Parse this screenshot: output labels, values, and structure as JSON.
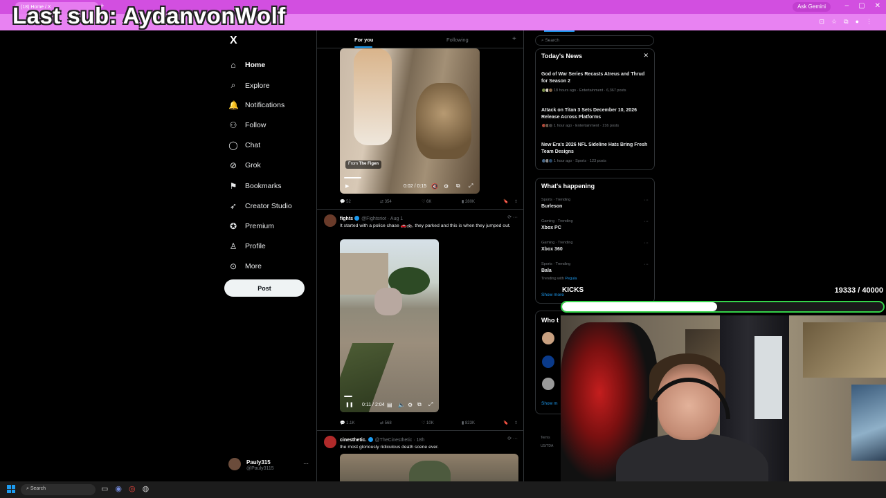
{
  "browser": {
    "tab_title": "(18) Home / X",
    "new_tab": "+",
    "ask_gemini": "Ask Gemini"
  },
  "overlay": {
    "last_sub": "Last sub: AydanvonWolf",
    "goal_label": "KICKS",
    "goal_count": "19333 / 40000",
    "goal_progress": 0.483
  },
  "nav": {
    "logo": "X",
    "items": [
      {
        "label": "Home",
        "icon": "home-icon"
      },
      {
        "label": "Explore",
        "icon": "search-icon"
      },
      {
        "label": "Notifications",
        "icon": "bell-icon"
      },
      {
        "label": "Follow",
        "icon": "add-user-icon"
      },
      {
        "label": "Chat",
        "icon": "chat-icon"
      },
      {
        "label": "Grok",
        "icon": "grok-icon"
      },
      {
        "label": "Bookmarks",
        "icon": "bookmark-icon"
      },
      {
        "label": "Creator Studio",
        "icon": "rocket-icon"
      },
      {
        "label": "Premium",
        "icon": "premium-icon"
      },
      {
        "label": "Profile",
        "icon": "profile-icon"
      },
      {
        "label": "More",
        "icon": "more-icon"
      }
    ],
    "post_label": "Post",
    "account": {
      "name": "Pauly315",
      "handle": "@Pauly3115",
      "more": "···"
    }
  },
  "feed": {
    "tabs": [
      "For you",
      "Following"
    ],
    "plus": "+",
    "tweet1": {
      "from_prefix": "From",
      "from_name": "The Figen",
      "time": "0:02 / 0:15",
      "progress": 0.13,
      "actions": {
        "reply": "52",
        "repost": "354",
        "like": "6K",
        "views": "280K"
      }
    },
    "tweet2": {
      "name": "fights",
      "handle": "@Fightsriot · Aug 1",
      "text": "It started with a police chase 🚗🚓, they parked and this is when they jumped out.",
      "time": "0:11 / 2:04",
      "progress": 0.09,
      "actions": {
        "reply": "1.1K",
        "repost": "568",
        "like": "10K",
        "views": "823K"
      }
    },
    "tweet3": {
      "name": "cinesthetic.",
      "handle": "@TheCinesthetic · 18h",
      "text": "the most gloriously ridiculous death scene ever."
    }
  },
  "sidebar": {
    "search_placeholder": "Search",
    "news": {
      "title": "Today's News",
      "close": "✕",
      "items": [
        {
          "title": "God of War Series Recasts Atreus and Thrud for Season 2",
          "meta": "18 hours ago · Entertainment · 6,367 posts"
        },
        {
          "title": "Attack on Titan 3 Sets December 10, 2026 Release Across Platforms",
          "meta": "1 hour ago · Entertainment · 216 posts"
        },
        {
          "title": "New Era's 2026 NFL Sideline Hats Bring Fresh Team Designs",
          "meta": "1 hour ago · Sports · 123 posts"
        }
      ]
    },
    "happening": {
      "title": "What's happening",
      "items": [
        {
          "category": "Sports · Trending",
          "name": "Burleson"
        },
        {
          "category": "Gaming · Trending",
          "name": "Xbox PC"
        },
        {
          "category": "Gaming · Trending",
          "name": "Xbox 360"
        },
        {
          "category": "Sports · Trending",
          "name": "Bala",
          "with_prefix": "Trending with",
          "with_name": "Pegula"
        }
      ],
      "show_more": "Show more"
    },
    "who": {
      "title": "Who t",
      "show_more": "Show m"
    },
    "footer": {
      "terms": "Terms",
      "region": "US/TDA"
    }
  },
  "taskbar": {
    "search": "Search"
  },
  "colors": {
    "accent": "#1d9bf0",
    "chrome": "#d24fe0",
    "goal_bar": "#35d44a"
  }
}
